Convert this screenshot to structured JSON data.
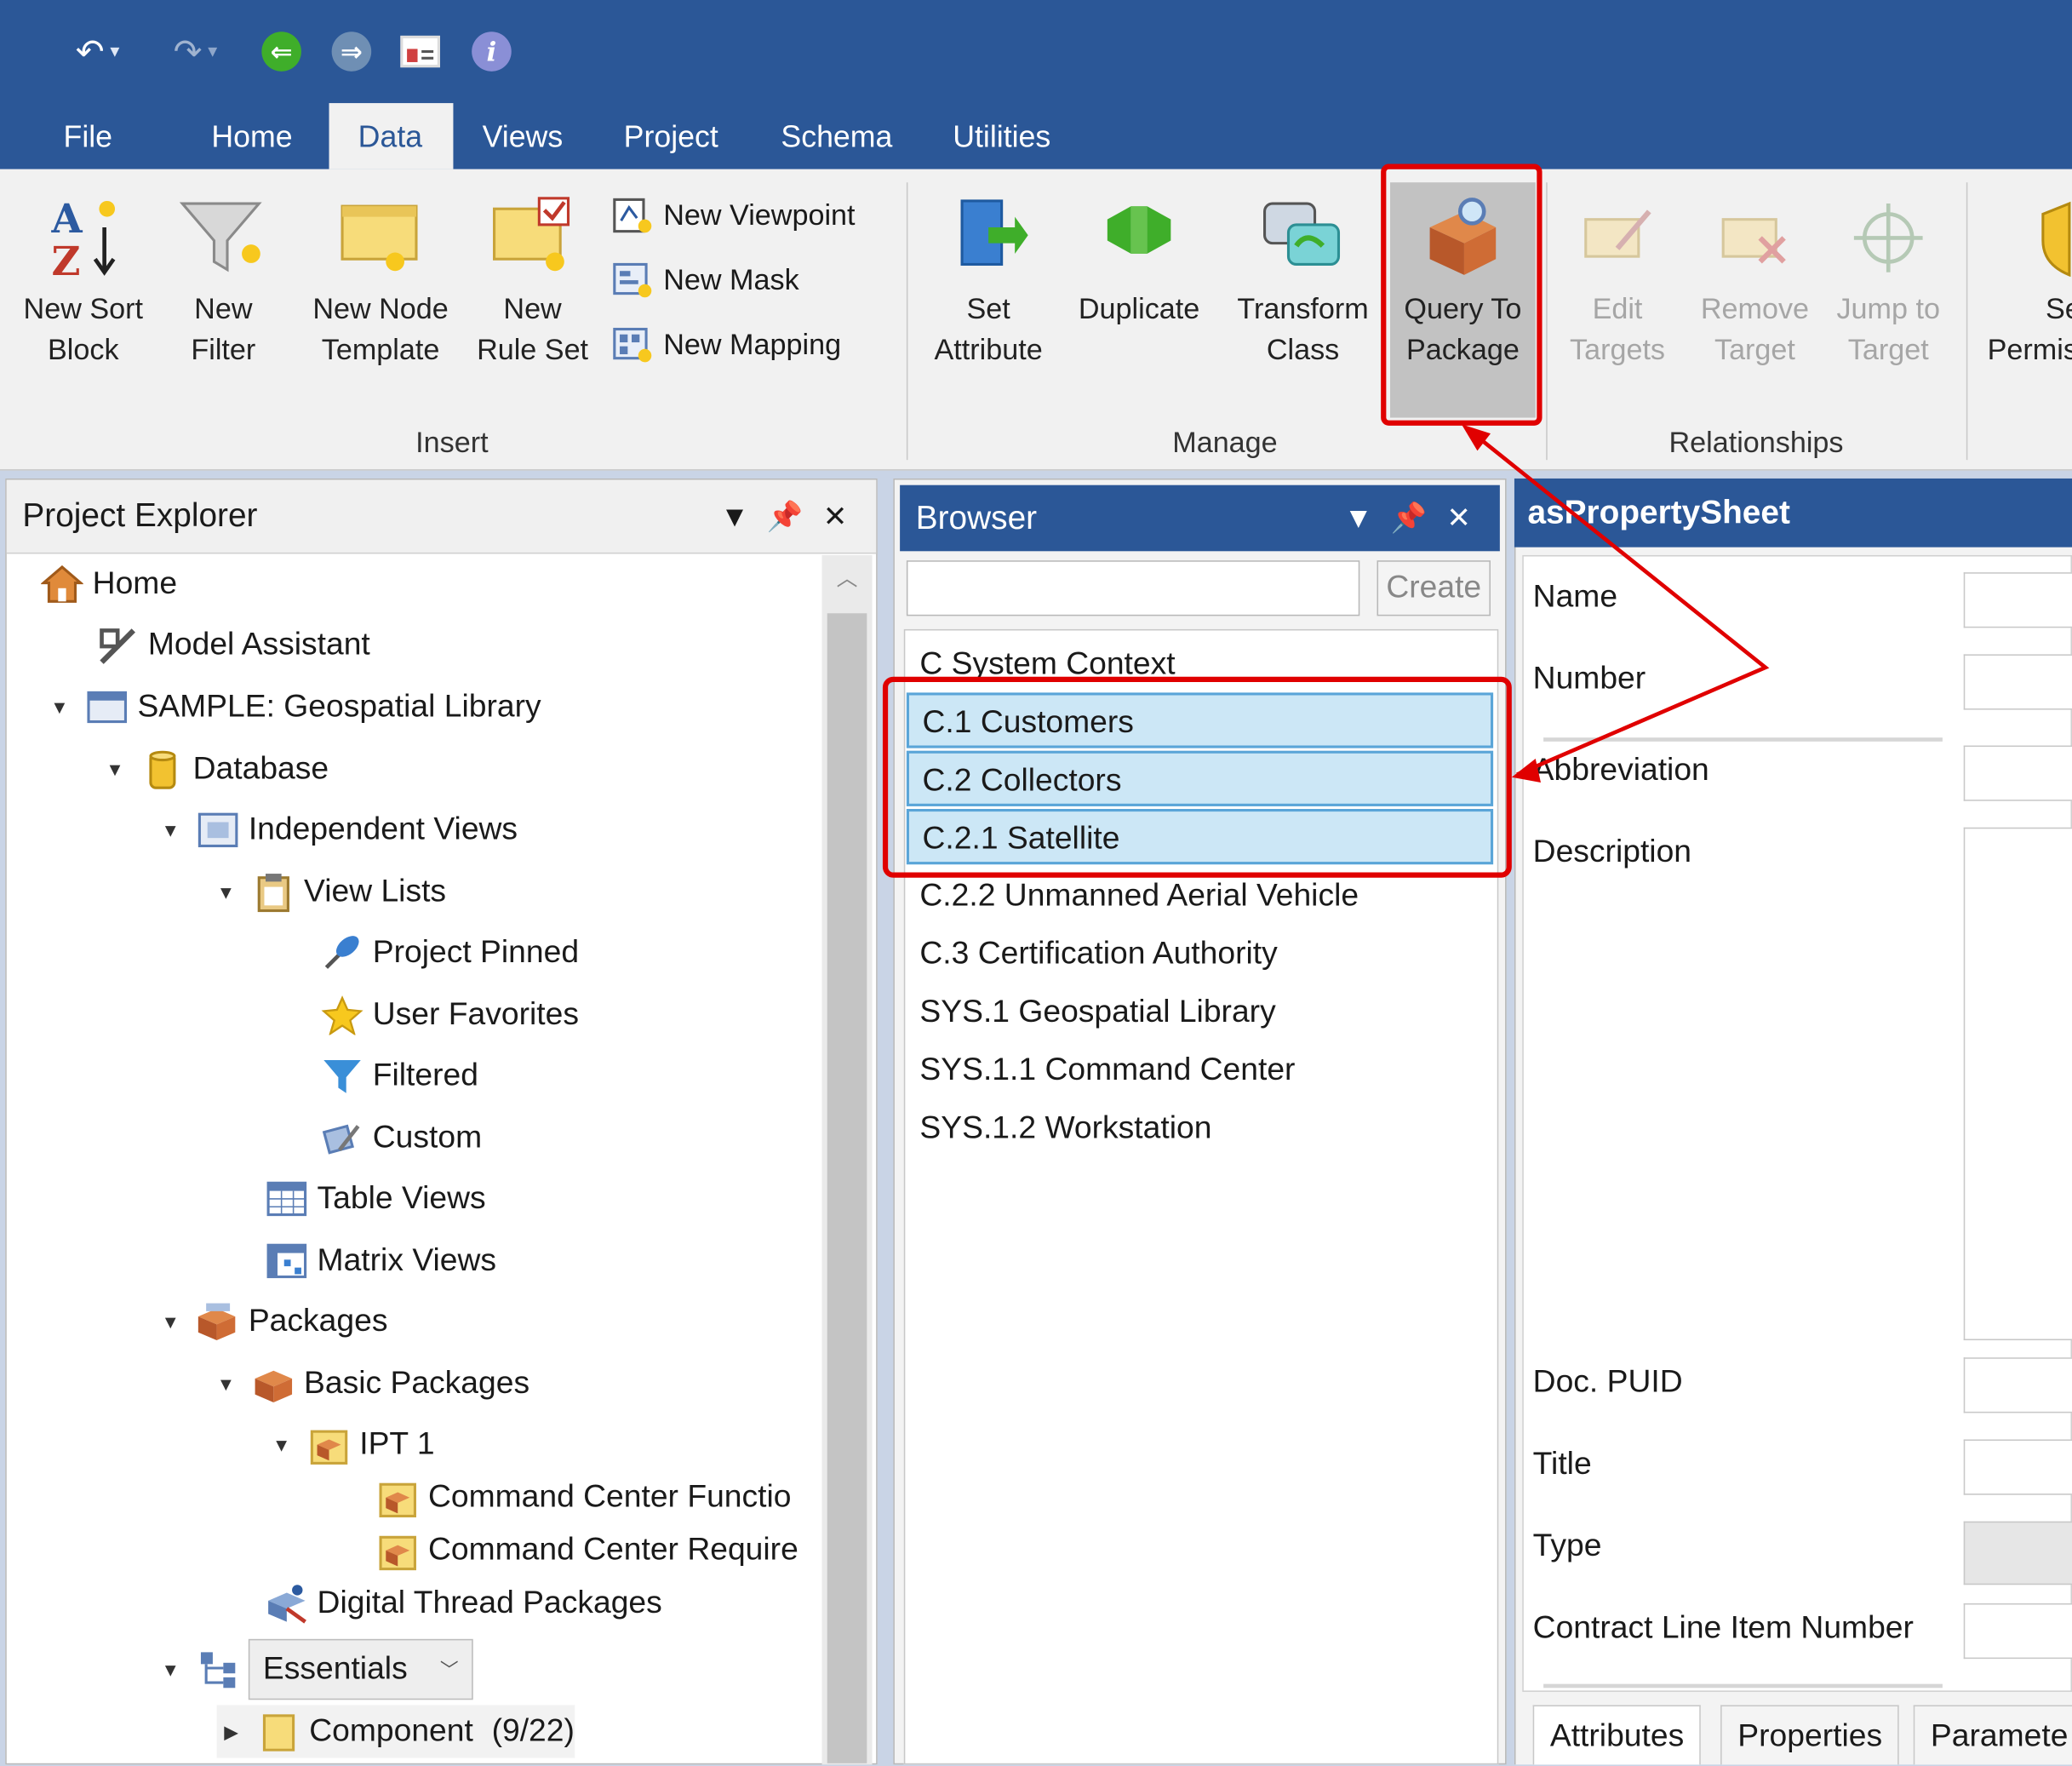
{
  "ribbon_tabs": [
    "File",
    "Home",
    "Data",
    "Views",
    "Project",
    "Schema",
    "Utilities"
  ],
  "insert_group": {
    "label": "Insert",
    "new_sort_block": [
      "New Sort",
      "Block"
    ],
    "new_filter": [
      "New",
      "Filter"
    ],
    "new_node_template": [
      "New Node",
      "Template"
    ],
    "new_rule_set": [
      "New",
      "Rule Set"
    ],
    "new_viewpoint": "New Viewpoint",
    "new_mask": "New Mask",
    "new_mapping": "New Mapping"
  },
  "manage_group": {
    "label": "Manage",
    "set_attribute": [
      "Set",
      "Attribute"
    ],
    "duplicate": "Duplicate",
    "transform_class": [
      "Transform",
      "Class"
    ],
    "query_to_package": [
      "Query To",
      "Package"
    ]
  },
  "relationships_group": {
    "label": "Relationships",
    "edit_targets": [
      "Edit",
      "Targets"
    ],
    "remove_target": [
      "Remove",
      "Target"
    ],
    "jump_to_target": [
      "Jump to",
      "Target"
    ]
  },
  "cut_button": [
    "Se",
    "Permis"
  ],
  "project_explorer": {
    "title": "Project Explorer",
    "items": {
      "home": "Home",
      "model_assistant": "Model Assistant",
      "sample": "SAMPLE: Geospatial Library",
      "database": "Database",
      "independent_views": "Independent Views",
      "view_lists": "View Lists",
      "project_pinned": "Project Pinned",
      "user_favorites": "User Favorites",
      "filtered": "Filtered",
      "custom": "Custom",
      "table_views": "Table Views",
      "matrix_views": "Matrix Views",
      "packages": "Packages",
      "basic_packages": "Basic Packages",
      "ipt1": "IPT 1",
      "cmd_center_func": "Command Center Functio",
      "cmd_center_req": "Command Center Require",
      "digital_thread": "Digital Thread Packages",
      "essentials": "Essentials",
      "component": "Component",
      "component_count": "(9/22)"
    }
  },
  "browser": {
    "title": "Browser",
    "search_value": "",
    "create_label": "Create",
    "items": [
      "C System Context",
      "C.1 Customers",
      "C.2 Collectors",
      "C.2.1 Satellite",
      "C.2.2 Unmanned Aerial Vehicle",
      "C.3 Certification Authority",
      "SYS.1 Geospatial Library",
      "SYS.1.1 Command Center",
      "SYS.1.2 Workstation"
    ]
  },
  "property_sheet": {
    "title": "asPropertySheet",
    "labels": {
      "name": "Name",
      "number": "Number",
      "abbreviation": "Abbreviation",
      "description": "Description",
      "doc_puid": "Doc. PUID",
      "title": "Title",
      "type": "Type",
      "clin": "Contract Line Item Number"
    },
    "tabs": [
      "Attributes",
      "Properties",
      "Paramete"
    ]
  },
  "colors": {
    "title_blue": "#2b5797",
    "highlight_red": "#e00000",
    "selection_fill": "#cce7f6"
  }
}
